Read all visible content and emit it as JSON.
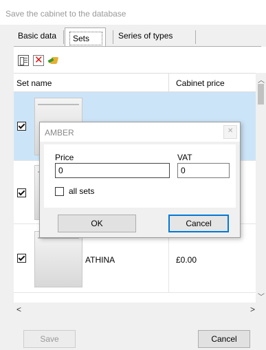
{
  "window": {
    "title": "Save the cabinet to the database"
  },
  "tabs": [
    {
      "label": "Basic data"
    },
    {
      "label": "Sets"
    },
    {
      "label": "Series of types"
    }
  ],
  "toolbar": {
    "icons": [
      "select-all-icon",
      "delete-icon",
      "refresh-icon"
    ]
  },
  "grid": {
    "columns": [
      "Set name",
      "Cabinet price"
    ],
    "rows": [
      {
        "checked": true,
        "name": "",
        "price": "",
        "selected": true
      },
      {
        "checked": true,
        "name": "",
        "price": ""
      },
      {
        "checked": true,
        "name": "ATHINA",
        "price": "£0.00"
      },
      {
        "checked": false,
        "name": "",
        "price": ""
      }
    ]
  },
  "footer": {
    "save_label": "Save",
    "cancel_label": "Cancel"
  },
  "dialog": {
    "title": "AMBER",
    "price_label": "Price",
    "price_value": "0",
    "vat_label": "VAT",
    "vat_value": "0",
    "all_sets_label": "all sets",
    "ok_label": "OK",
    "cancel_label": "Cancel"
  },
  "colors": {
    "selection": "#cce4f7",
    "focus_border": "#0078d7"
  }
}
